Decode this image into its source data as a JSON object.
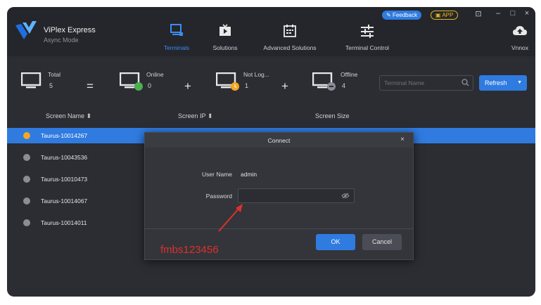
{
  "app": {
    "title": "ViPlex Express",
    "mode": "Async Mode"
  },
  "topbar": {
    "feedback": "Feedback",
    "app_btn": "APP",
    "nav": [
      {
        "label": "Terminals",
        "icon": "terminals-icon",
        "active": true
      },
      {
        "label": "Solutions",
        "icon": "solutions-icon"
      },
      {
        "label": "Advanced Solutions",
        "icon": "calendar-icon"
      },
      {
        "label": "Terminal Control",
        "icon": "sliders-icon"
      },
      {
        "label": "Vnnox",
        "icon": "cloud-upload-icon"
      }
    ]
  },
  "stats": {
    "total_label": "Total",
    "total": "5",
    "online_label": "Online",
    "online": "0",
    "notlog_label": "Not Log...",
    "notlog": "1",
    "offline_label": "Offline",
    "offline": "4",
    "eq": "=",
    "plus": "+"
  },
  "search": {
    "placeholder": "Terminal Name"
  },
  "refresh": "Refresh",
  "table": {
    "headers": [
      "Screen Name ⬍",
      "Screen IP ⬍",
      "Screen Size"
    ],
    "rows": [
      {
        "name": "Taurus-10014267",
        "status": "notlog"
      },
      {
        "name": "Taurus-10043536",
        "status": "offline"
      },
      {
        "name": "Taurus-10010473",
        "status": "offline"
      },
      {
        "name": "Taurus-10014067",
        "status": "offline"
      },
      {
        "name": "Taurus-10014011",
        "status": "offline"
      }
    ]
  },
  "modal": {
    "title": "Connect",
    "close": "×",
    "user_label": "User Name",
    "user_value": "admin",
    "password_label": "Password",
    "ok": "OK",
    "cancel": "Cancel"
  },
  "annotation": "fmbs123456",
  "colors": {
    "accent": "#2f7be0",
    "notlog": "#f5a623",
    "offline": "#8a8d93",
    "online_badge": "#4caf50",
    "annotation": "#e0302a"
  }
}
